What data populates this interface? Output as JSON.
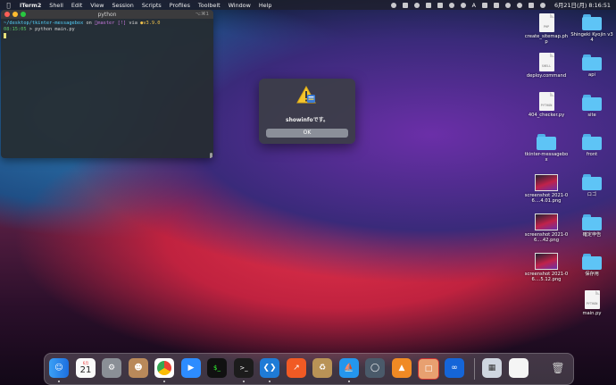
{
  "menubar": {
    "app_name": "iTerm2",
    "items": [
      "Shell",
      "Edit",
      "View",
      "Session",
      "Scripts",
      "Profiles",
      "Toolbelt",
      "Window",
      "Help"
    ],
    "input_indicator": "A",
    "clock": "6月21日(月)  8:16:51"
  },
  "terminal": {
    "title": "python",
    "shortcut": "⌥⌘1",
    "line1_path": "~/desktop/tkinter-messagebox",
    "line1_on": " on ",
    "line1_git": "master [!]",
    "line1_via": " via ",
    "line1_py": "v3.9.0",
    "line2_time": "08:15:05",
    "line2_cmd": " > python main.py"
  },
  "dialog": {
    "message": "showinfoです。",
    "ok_label": "OK"
  },
  "desktop": {
    "icons": [
      {
        "label": "create_sitemap.php",
        "tag": "PHP"
      },
      {
        "label": "Shingeki Kyojin v34"
      },
      {
        "label": "deploy.command",
        "tag": "SHELL"
      },
      {
        "label": "api"
      },
      {
        "label": "404_checker.py",
        "tag": "PYTHON"
      },
      {
        "label": "site"
      },
      {
        "label": "tkinter-messagebox"
      },
      {
        "label": "front"
      },
      {
        "label": "screenshot 2021-06....4.01.png"
      },
      {
        "label": "ロゴ"
      },
      {
        "label": "screenshot 2021-06....42.png"
      },
      {
        "label": "確定申告"
      },
      {
        "label": "screenshot 2021-06....5.12.png"
      },
      {
        "label": "保存用"
      },
      {
        "label": "main.py",
        "tag": "PYTHON"
      }
    ]
  },
  "dock": {
    "calendar_month": "6月",
    "calendar_day": "21"
  }
}
